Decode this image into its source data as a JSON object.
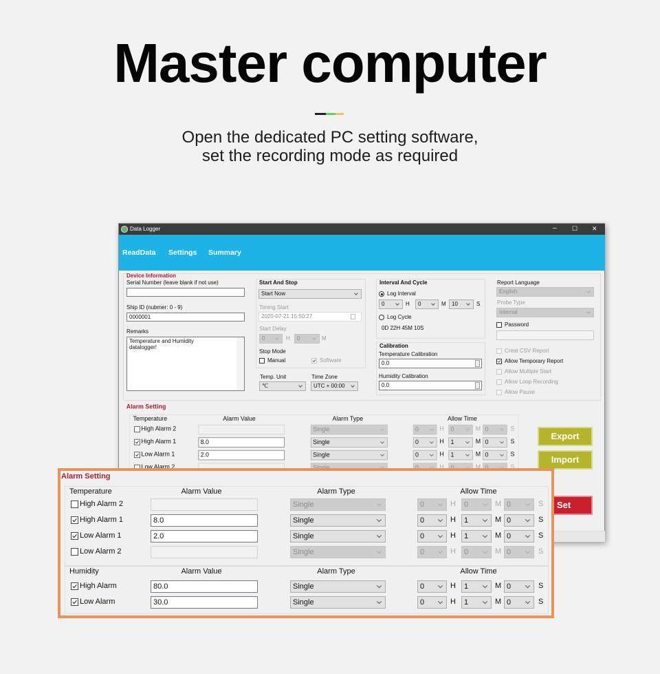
{
  "hero": {
    "title": "Master computer",
    "subtitle_line1": "Open the dedicated PC setting software,",
    "subtitle_line2": "set the recording mode as required",
    "accent_colors": [
      "#222222",
      "#5fd35a",
      "#f0c65a"
    ]
  },
  "window": {
    "title": "Data Logger",
    "app_icon": "data-logger-app-icon",
    "header_color": "#1eb3e6",
    "controls": {
      "minimize": "–",
      "maximize": "☐",
      "close": "✕"
    },
    "tabs": [
      "ReadData",
      "Settings",
      "Summary"
    ],
    "device_info": {
      "title": "Device Information",
      "serial_label": "Serial Number (leave blank if not use)",
      "serial_value": "",
      "ship_label": "Ship ID (nubmer: 0 - 9)",
      "ship_value": "0000001",
      "remarks_label": "Remarks",
      "remarks_value": "Temperature and Humidity\ndatalogger!"
    },
    "start_stop": {
      "title": "Start And Stop",
      "mode": "Start Now",
      "timing_start_label": "Timing Start",
      "timing_start_value": "2020-07-21 15:50:27",
      "start_delay_label": "Start Delay",
      "delay_h": "0",
      "delay_m": "0",
      "h": "H",
      "m": "M",
      "stop_mode_label": "Stop Mode",
      "manual_label": "Manual",
      "manual_checked": false,
      "software_label": "Software",
      "software_checked": true
    },
    "temp_unit": {
      "label": "Temp. Unit",
      "value": "℃"
    },
    "time_zone": {
      "label": "Time Zone",
      "value": "UTC + 00:00"
    },
    "interval": {
      "title": "Interval And Cycle",
      "log_interval_label": "Log Interval",
      "selected": "log_interval",
      "h": "0",
      "m": "0",
      "s": "10",
      "h_unit": "H",
      "m_unit": "M",
      "s_unit": "S",
      "log_cycle_label": "Log Cycle",
      "cycle_value": "0D 22H 45M 10S"
    },
    "calibration": {
      "title": "Calibration",
      "temp_label": "Temperature Calibration",
      "temp_value": "0.0",
      "hum_label": "Humidity Calibration",
      "hum_value": "0.0"
    },
    "report": {
      "language_label": "Report Language",
      "language_value": "English",
      "probe_label": "Probe Type",
      "probe_value": "Internal",
      "password_label": "Password",
      "password_checked": false,
      "options": [
        {
          "label": "Creat CSV Report",
          "checked": false,
          "enabled": false
        },
        {
          "label": "Allow Temporary Report",
          "checked": true,
          "enabled": true
        },
        {
          "label": "Allow Multiple Start",
          "checked": false,
          "enabled": false
        },
        {
          "label": "Allow Loop Recording",
          "checked": false,
          "enabled": false
        },
        {
          "label": "Allow Pause",
          "checked": false,
          "enabled": false
        }
      ]
    },
    "buttons": {
      "export": "Export",
      "import": "Import",
      "set": "Set",
      "export_color": "#b5b52c",
      "set_color": "#c8202d"
    }
  },
  "alarm_setting": {
    "title": "Alarm Setting",
    "units": {
      "h": "H",
      "m": "M",
      "s": "S"
    },
    "temperature": {
      "header": "Temperature",
      "value_header": "Alarm Value",
      "type_header": "Alarm Type",
      "time_header": "Allow Time",
      "rows": [
        {
          "label": "High Alarm 2",
          "checked": false,
          "enabled": false,
          "value": "",
          "type": "Single",
          "h": "0",
          "m": "0",
          "s": "0"
        },
        {
          "label": "High Alarm 1",
          "checked": true,
          "enabled": true,
          "value": "8.0",
          "type": "Single",
          "h": "0",
          "m": "1",
          "s": "0"
        },
        {
          "label": "Low Alarm 1",
          "checked": true,
          "enabled": true,
          "value": "2.0",
          "type": "Single",
          "h": "0",
          "m": "1",
          "s": "0"
        },
        {
          "label": "Low Alarm 2",
          "checked": false,
          "enabled": false,
          "value": "",
          "type": "Single",
          "h": "0",
          "m": "0",
          "s": "0"
        }
      ]
    },
    "humidity": {
      "header": "Humidity",
      "value_header": "Alarm Value",
      "type_header": "Alarm Type",
      "time_header": "Allow Time",
      "rows": [
        {
          "label": "High Alarm",
          "checked": true,
          "enabled": true,
          "value": "80.0",
          "type": "Single",
          "h": "0",
          "m": "1",
          "s": "0"
        },
        {
          "label": "Low Alarm",
          "checked": true,
          "enabled": true,
          "value": "30.0",
          "type": "Single",
          "h": "0",
          "m": "1",
          "s": "0"
        }
      ]
    },
    "highlight_color": "#e8935a"
  }
}
